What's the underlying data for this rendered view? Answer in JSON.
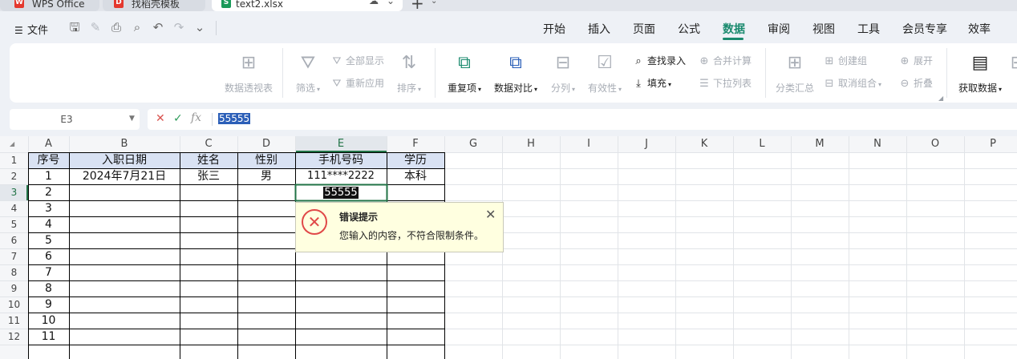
{
  "tabs": [
    {
      "label": "WPS Office",
      "icon": "W",
      "color": "#e4382e"
    },
    {
      "label": "找稻壳模板",
      "icon": "D",
      "color": "#e4382e"
    },
    {
      "label": "text2.xlsx",
      "icon": "S",
      "color": "#1a9a5a"
    }
  ],
  "menubar": {
    "file": "文件",
    "tabs": [
      "开始",
      "插入",
      "页面",
      "公式",
      "数据",
      "审阅",
      "视图",
      "工具",
      "会员专享",
      "效率"
    ],
    "active": "数据"
  },
  "ribbon": {
    "pivot": "数据透视表",
    "filter": "筛选",
    "show_all": "全部显示",
    "reapply": "重新应用",
    "sort": "排序",
    "duplicates": "重复项",
    "compare": "数据对比",
    "split": "分列",
    "validation": "有效性",
    "find_entry": "查找录入",
    "fill": "填充",
    "consolidate": "合并计算",
    "dropdown_list": "下拉列表",
    "subtotal": "分类汇总",
    "create_group": "创建组",
    "ungroup": "取消组合",
    "expand": "展开",
    "collapse": "折叠",
    "get_data": "获取数据"
  },
  "formula_bar": {
    "cell_ref": "E3",
    "value": "55555"
  },
  "columns": [
    "A",
    "B",
    "C",
    "D",
    "E",
    "F",
    "G",
    "H",
    "I",
    "J",
    "K",
    "L",
    "M",
    "N",
    "O",
    "P"
  ],
  "rows": [
    "1",
    "2",
    "3",
    "4",
    "5",
    "6",
    "7",
    "8",
    "9",
    "10",
    "11",
    "12"
  ],
  "table": {
    "headers": [
      "序号",
      "入职日期",
      "姓名",
      "性别",
      "手机号码",
      "学历"
    ],
    "row1": [
      "1",
      "2024年7月21日",
      "张三",
      "男",
      "111****2222",
      "本科"
    ],
    "seq": [
      "2",
      "3",
      "4",
      "5",
      "6",
      "7",
      "8",
      "9",
      "10",
      "11"
    ],
    "editing_value": "55555"
  },
  "error_tip": {
    "title": "错误提示",
    "message": "您输入的内容，不符合限制条件。"
  }
}
